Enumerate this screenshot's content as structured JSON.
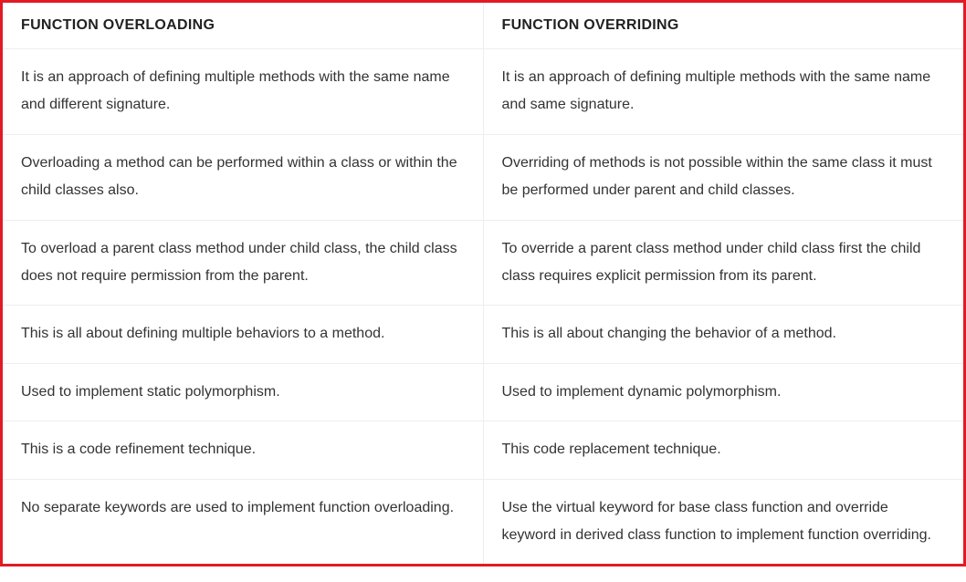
{
  "table": {
    "headers": {
      "left": "FUNCTION OVERLOADING",
      "right": "FUNCTION OVERRIDING"
    },
    "rows": [
      {
        "left": "It is an approach of defining multiple methods with the same name and different signature.",
        "right": "It is an approach of defining multiple methods with the same name and same signature."
      },
      {
        "left": "Overloading a method can be performed within a class or within the child classes also.",
        "right": "Overriding of methods is not possible within the same class it must be performed under parent and child classes."
      },
      {
        "left": "To overload a parent class method under child class, the child class does not require permission from the parent.",
        "right": "To override a parent class method under child class first the child class requires explicit permission from its parent."
      },
      {
        "left": "This is all about defining multiple behaviors to a method.",
        "right": "This is all about changing the behavior of a method."
      },
      {
        "left": "Used to implement static polymorphism.",
        "right": "Used to implement dynamic polymorphism."
      },
      {
        "left": "This is a code refinement technique.",
        "right": "This code replacement technique."
      },
      {
        "left": "No separate keywords are used to implement function overloading.",
        "right": "Use the virtual keyword for base class function and override keyword in derived class function to implement function overriding."
      }
    ]
  }
}
